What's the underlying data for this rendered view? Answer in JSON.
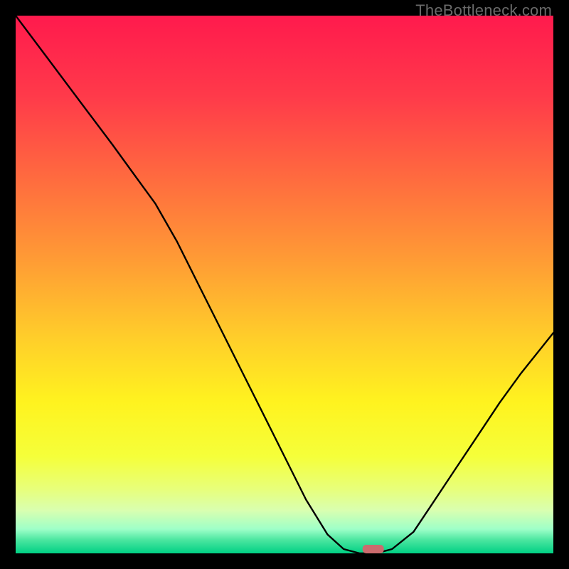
{
  "watermark": "TheBottleneck.com",
  "chart_data": {
    "type": "line",
    "title": "",
    "xlabel": "",
    "ylabel": "",
    "xlim": [
      0,
      100
    ],
    "ylim": [
      0,
      100
    ],
    "grid": false,
    "legend": false,
    "curve_points_xy": [
      [
        0.0,
        100.0
      ],
      [
        6.0,
        92.0
      ],
      [
        12.0,
        84.0
      ],
      [
        18.0,
        76.0
      ],
      [
        22.0,
        70.5
      ],
      [
        26.0,
        65.0
      ],
      [
        30.0,
        58.0
      ],
      [
        34.0,
        50.0
      ],
      [
        38.0,
        42.0
      ],
      [
        42.0,
        34.0
      ],
      [
        46.0,
        26.0
      ],
      [
        50.0,
        18.0
      ],
      [
        54.0,
        10.0
      ],
      [
        58.0,
        3.5
      ],
      [
        61.0,
        0.8
      ],
      [
        64.0,
        0.0
      ],
      [
        67.0,
        0.0
      ],
      [
        70.0,
        0.8
      ],
      [
        74.0,
        4.0
      ],
      [
        78.0,
        10.0
      ],
      [
        82.0,
        16.0
      ],
      [
        86.0,
        22.0
      ],
      [
        90.0,
        28.0
      ],
      [
        94.0,
        33.5
      ],
      [
        100.0,
        41.0
      ]
    ],
    "marker": {
      "x": 66.5,
      "y": 0.8
    },
    "gradient_stops": [
      {
        "offset": 0.0,
        "color": "#ff1a4d"
      },
      {
        "offset": 0.15,
        "color": "#ff3a4a"
      },
      {
        "offset": 0.3,
        "color": "#ff6a3f"
      },
      {
        "offset": 0.45,
        "color": "#ff9a35"
      },
      {
        "offset": 0.6,
        "color": "#ffce2a"
      },
      {
        "offset": 0.72,
        "color": "#fff31f"
      },
      {
        "offset": 0.82,
        "color": "#f5ff3a"
      },
      {
        "offset": 0.88,
        "color": "#e8ff7a"
      },
      {
        "offset": 0.92,
        "color": "#d9ffb0"
      },
      {
        "offset": 0.955,
        "color": "#9effc8"
      },
      {
        "offset": 0.975,
        "color": "#4be6a0"
      },
      {
        "offset": 1.0,
        "color": "#00d084"
      }
    ]
  }
}
